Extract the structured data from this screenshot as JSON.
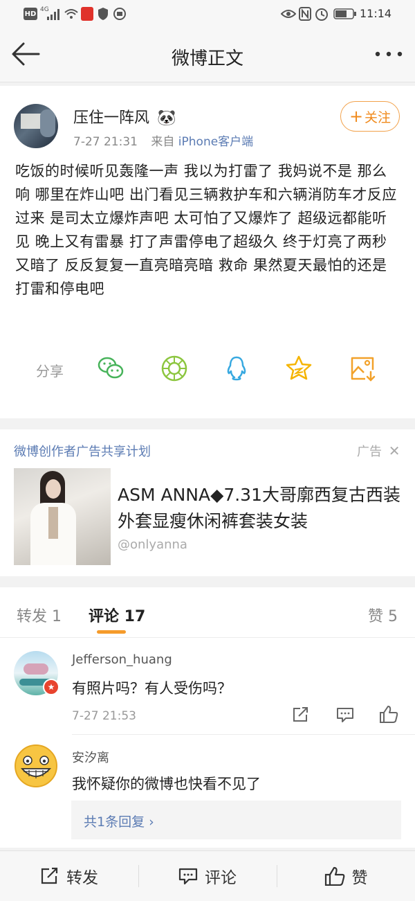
{
  "status_bar": {
    "left_badges": [
      "HD",
      "4G"
    ],
    "time": "11:14"
  },
  "nav": {
    "title": "微博正文",
    "back_icon": "arrow-left-icon",
    "more_icon": "more-dots-icon"
  },
  "post": {
    "username": "压住一阵风",
    "username_emoji": "🐼",
    "time": "7-27 21:31",
    "from_prefix": "来自",
    "source": "iPhone客户端",
    "follow_label": "关注",
    "text": "吃饭的时候听见轰隆一声 我以为打雷了 我妈说不是 那么响 哪里在炸山吧 出门看见三辆救护车和六辆消防车才反应过来 是司太立爆炸声吧 太可怕了又爆炸了 超级远都能听见 晚上又有雷暴 打了声雷停电了超级久 终于灯亮了两秒又暗了 反反复复一直亮暗亮暗 救命 果然夏天最怕的还是打雷和停电吧",
    "share_label": "分享",
    "share_icons": [
      "wechat-icon",
      "moments-icon",
      "qq-icon",
      "favorite-star-icon",
      "save-image-icon"
    ]
  },
  "ad": {
    "program_label": "微博创作者广告共享计划",
    "ad_tag": "广告",
    "title": "ASM ANNA◆7.31大哥廓西复古西装外套显瘦休闲裤套装女装",
    "handle": "@onlyanna"
  },
  "tabs": {
    "repost": "转发 1",
    "comment": "评论 17",
    "like": "赞 5"
  },
  "comments": [
    {
      "name": "Jefferson_huang",
      "text": "有照片吗？有人受伤吗？",
      "time": "7-27 21:53"
    },
    {
      "name": "安汐离",
      "text": "我怀疑你的微博也快看不见了",
      "reply_summary": "共1条回复 ›"
    }
  ],
  "bottom_bar": {
    "repost": "转发",
    "comment": "评论",
    "like": "赞"
  },
  "colors": {
    "accent_orange": "#f08a1c",
    "link_blue": "#5b7bb3"
  }
}
